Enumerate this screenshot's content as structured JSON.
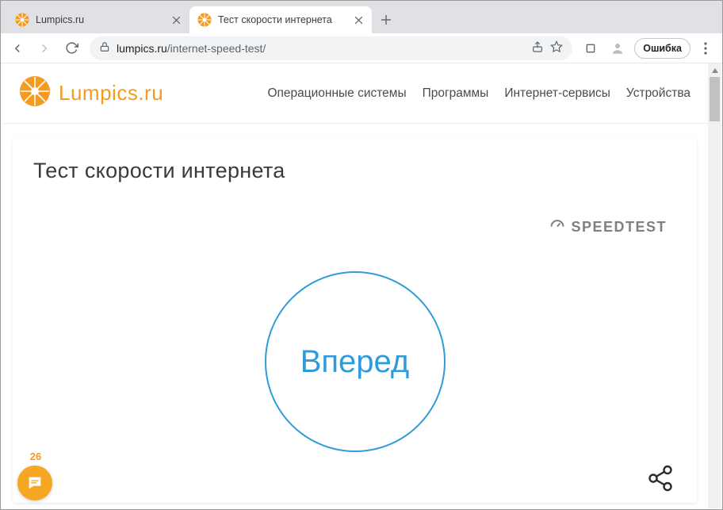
{
  "tabs": [
    {
      "title": "Lumpics.ru",
      "active": false
    },
    {
      "title": "Тест скорости интернета",
      "active": true
    }
  ],
  "address": {
    "host": "lumpics.ru",
    "path": "/internet-speed-test/"
  },
  "toolbar": {
    "error_label": "Ошибка"
  },
  "site": {
    "logo_text": "Lumpics.ru",
    "nav": [
      "Операционные системы",
      "Программы",
      "Интернет-сервисы",
      "Устройства"
    ]
  },
  "page": {
    "title": "Тест скорости интернета",
    "speedtest_label": "SPEEDTEST",
    "go_label": "Вперед"
  },
  "chat": {
    "count": "26"
  }
}
